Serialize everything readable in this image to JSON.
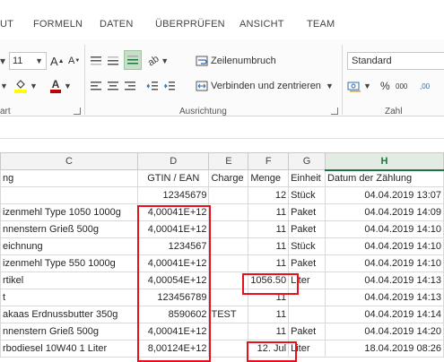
{
  "ribbon_tabs": [
    "UT",
    "FORMELN",
    "DATEN",
    "ÜBERPRÜFEN",
    "ANSICHT",
    "TEAM"
  ],
  "ribbon": {
    "font_size": "11",
    "grow_font": "A",
    "shrink_font": "A",
    "wrap_text": "Zeilenumbruch",
    "merge_center": "Verbinden und zentrieren",
    "number_format": "Standard",
    "percent": "%",
    "thousands": "000",
    "decimals": ",00",
    "group_labels": {
      "font": "art",
      "alignment": "Ausrichtung",
      "number": "Zahl"
    }
  },
  "columns": [
    "C",
    "D",
    "E",
    "F",
    "G",
    "H"
  ],
  "selected_column": "H",
  "header_row": [
    "ng",
    "GTIN / EAN",
    "Charge",
    "Menge",
    "Einheit",
    "Datum der Zählung"
  ],
  "rows": [
    [
      "",
      "12345679",
      "",
      "12",
      "Stück",
      "04.04.2019 13:07"
    ],
    [
      "izenmehl Type 1050 1000g",
      "4,00041E+12",
      "",
      "11",
      "Paket",
      "04.04.2019 14:09"
    ],
    [
      "nnenstern Grieß 500g",
      "4,00041E+12",
      "",
      "11",
      "Paket",
      "04.04.2019 14:10"
    ],
    [
      "eichnung",
      "1234567",
      "",
      "11",
      "Stück",
      "04.04.2019 14:10"
    ],
    [
      "izenmehl Type 550 1000g",
      "4,00041E+12",
      "",
      "11",
      "Paket",
      "04.04.2019 14:10"
    ],
    [
      "rtikel",
      "4,00054E+12",
      "",
      "1056.50",
      "Liter",
      "04.04.2019 14:13"
    ],
    [
      "t",
      "123456789",
      "",
      "11",
      "",
      "04.04.2019 14:13"
    ],
    [
      "akaas Erdnussbutter 350g",
      "8590602",
      "TEST",
      "11",
      "",
      "04.04.2019 14:14"
    ],
    [
      "nnenstern Grieß 500g",
      "4,00041E+12",
      "",
      "11",
      "Paket",
      "04.04.2019 14:20"
    ],
    [
      "rbodiesel 10W40 1 Liter",
      "8,00124E+12",
      "",
      "12. Jul",
      "Liter",
      "18.04.2019 08:26"
    ]
  ],
  "colors": {
    "excel_green": "#217346",
    "highlight_red": "#e8111b",
    "font_color_red": "#c00000",
    "highlight_yellow": "#ffff00"
  }
}
